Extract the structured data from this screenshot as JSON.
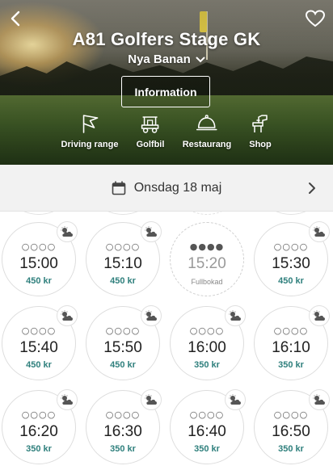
{
  "header": {
    "club_name": "A81 Golfers Stage GK",
    "course_name": "Nya Banan",
    "info_label": "Information",
    "back_icon": "chevron-left-icon",
    "favorite_icon": "heart-outline-icon"
  },
  "facilities": [
    {
      "label": "Driving range",
      "icon": "flag-icon"
    },
    {
      "label": "Golfbil",
      "icon": "golf-cart-icon"
    },
    {
      "label": "Restaurang",
      "icon": "cloche-icon"
    },
    {
      "label": "Shop",
      "icon": "shop-icon"
    }
  ],
  "date_bar": {
    "date_label": "Onsdag 18 maj",
    "calendar_icon": "calendar-icon",
    "next_icon": "chevron-right-icon"
  },
  "colors": {
    "price": "#2e7f7c",
    "border": "#dddddd"
  },
  "slots": [
    {
      "time": "15:00",
      "price": "450 kr",
      "players": "○○○○",
      "weather_icon": "partly-cloudy-icon",
      "status": ""
    },
    {
      "time": "15:10",
      "price": "450 kr",
      "players": "○○○○",
      "weather_icon": "partly-cloudy-icon",
      "status": ""
    },
    {
      "time": "15:20",
      "price": "",
      "players": "●●●●",
      "weather_icon": "",
      "status": "Fullbokad"
    },
    {
      "time": "15:30",
      "price": "450 kr",
      "players": "○○○○",
      "weather_icon": "partly-cloudy-icon",
      "status": ""
    },
    {
      "time": "15:40",
      "price": "450 kr",
      "players": "○○○○",
      "weather_icon": "partly-cloudy-icon",
      "status": ""
    },
    {
      "time": "15:50",
      "price": "450 kr",
      "players": "○○○○",
      "weather_icon": "partly-cloudy-icon",
      "status": ""
    },
    {
      "time": "16:00",
      "price": "350 kr",
      "players": "○○○○",
      "weather_icon": "partly-cloudy-icon",
      "status": ""
    },
    {
      "time": "16:10",
      "price": "350 kr",
      "players": "○○○○",
      "weather_icon": "partly-cloudy-icon",
      "status": ""
    },
    {
      "time": "16:20",
      "price": "350 kr",
      "players": "○○○○",
      "weather_icon": "partly-cloudy-icon",
      "status": ""
    },
    {
      "time": "16:30",
      "price": "350 kr",
      "players": "○○○○",
      "weather_icon": "partly-cloudy-icon",
      "status": ""
    },
    {
      "time": "16:40",
      "price": "350 kr",
      "players": "○○○○",
      "weather_icon": "partly-cloudy-icon",
      "status": ""
    },
    {
      "time": "16:50",
      "price": "350 kr",
      "players": "○○○○",
      "weather_icon": "partly-cloudy-icon",
      "status": ""
    }
  ]
}
